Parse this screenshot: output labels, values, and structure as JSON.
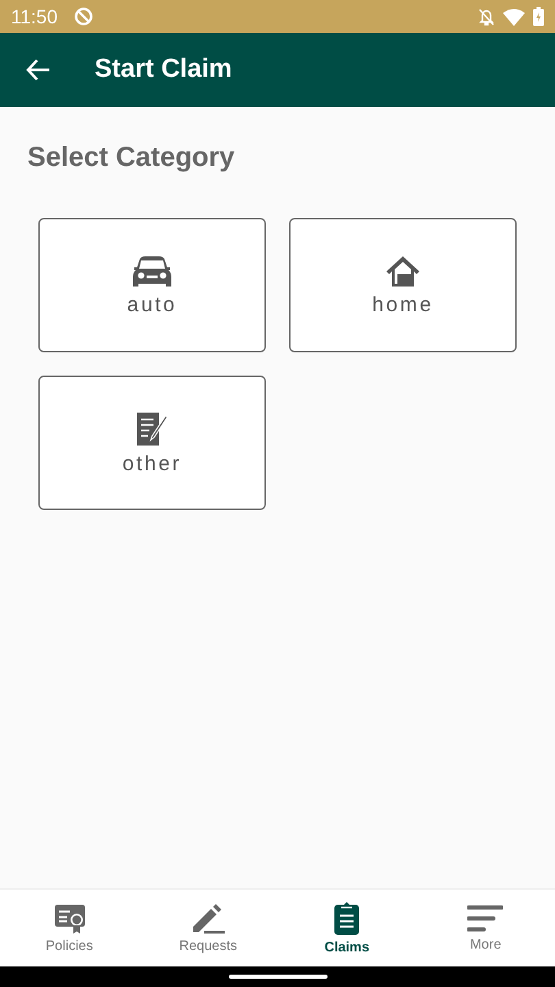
{
  "status_bar": {
    "time": "11:50"
  },
  "app_bar": {
    "title": "Start Claim"
  },
  "heading": "Select Category",
  "categories": [
    {
      "kind": "car",
      "label": "auto"
    },
    {
      "kind": "house",
      "label": "home"
    },
    {
      "kind": "note",
      "label": "other"
    }
  ],
  "bottom_nav": [
    {
      "kind": "certificate",
      "label": "Policies",
      "selected": false
    },
    {
      "kind": "pencil",
      "label": "Requests",
      "selected": false
    },
    {
      "kind": "clipboard",
      "label": "Claims",
      "selected": true
    },
    {
      "kind": "lines",
      "label": "More",
      "selected": false
    }
  ]
}
